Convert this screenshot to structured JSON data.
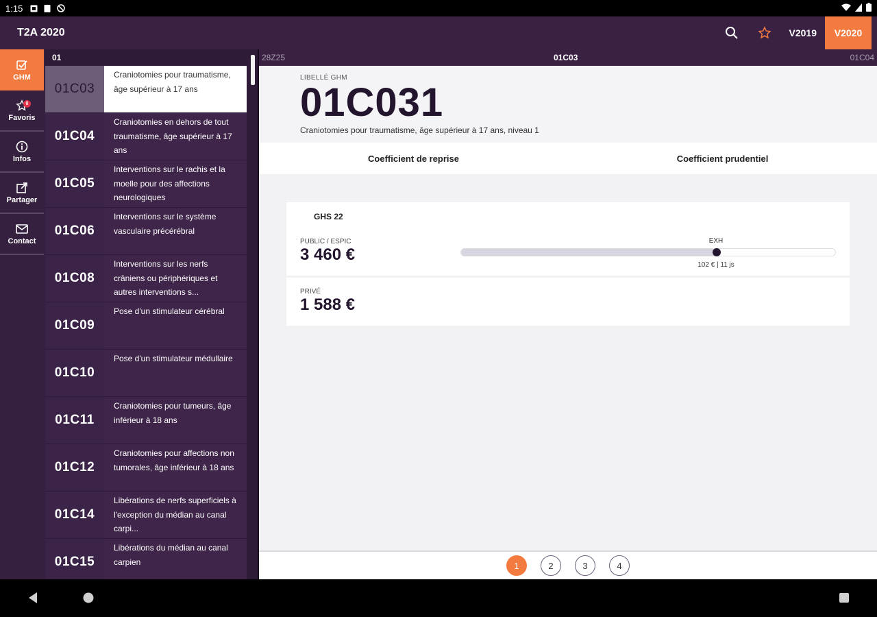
{
  "status_bar": {
    "time": "1:15"
  },
  "app_bar": {
    "title": "T2A 2020",
    "versions": [
      "V2019",
      "V2020"
    ],
    "active_version": "V2020"
  },
  "rail": {
    "items": [
      {
        "label": "GHM",
        "icon": "checkbox-icon",
        "active": true
      },
      {
        "label": "Favoris",
        "icon": "star-icon",
        "badge": "0"
      },
      {
        "label": "Infos",
        "icon": "info-icon"
      },
      {
        "label": "Partager",
        "icon": "share-icon"
      },
      {
        "label": "Contact",
        "icon": "mail-icon"
      }
    ]
  },
  "list": {
    "header": "01",
    "items": [
      {
        "code": "01C03",
        "desc": "Craniotomies pour traumatisme, âge supérieur à 17 ans",
        "selected": true
      },
      {
        "code": "01C04",
        "desc": "Craniotomies en dehors de tout traumatisme, âge supérieur à 17 ans"
      },
      {
        "code": "01C05",
        "desc": "Interventions sur le rachis et la moelle pour des affections neurologiques"
      },
      {
        "code": "01C06",
        "desc": "Interventions sur le système vasculaire précérébral"
      },
      {
        "code": "01C08",
        "desc": "Interventions sur les nerfs crâniens ou périphériques et autres interventions s..."
      },
      {
        "code": "01C09",
        "desc": "Pose d'un stimulateur cérébral"
      },
      {
        "code": "01C10",
        "desc": "Pose d'un stimulateur médullaire"
      },
      {
        "code": "01C11",
        "desc": "Craniotomies pour tumeurs, âge inférieur à 18 ans"
      },
      {
        "code": "01C12",
        "desc": "Craniotomies pour affections non tumorales, âge inférieur à 18 ans"
      },
      {
        "code": "01C14",
        "desc": "Libérations de nerfs superficiels à l'exception du médian au canal carpi..."
      },
      {
        "code": "01C15",
        "desc": "Libérations du médian au canal carpien"
      }
    ]
  },
  "tabs": {
    "prev": "28Z25",
    "current": "01C03",
    "next": "01C04"
  },
  "detail": {
    "label": "LIBELLÉ GHM",
    "code": "01C031",
    "subtitle": "Craniotomies pour traumatisme, âge supérieur à 17 ans, niveau 1",
    "coef_reprise": "Coefficient de reprise",
    "coef_prudentiel": "Coefficient prudentiel",
    "ghs": "GHS 22",
    "public_label": "PUBLIC / ESPIC",
    "public_value": "3 460 €",
    "prive_label": "PRIVÉ",
    "prive_value": "1 588 €",
    "exh_label": "EXH",
    "exh_info": "102 € | 11 js",
    "exh_fraction": 0.68
  },
  "pager": {
    "pages": [
      "1",
      "2",
      "3",
      "4"
    ],
    "active": "1"
  },
  "colors": {
    "accent": "#f47b3f",
    "dark": "#3a2144"
  }
}
